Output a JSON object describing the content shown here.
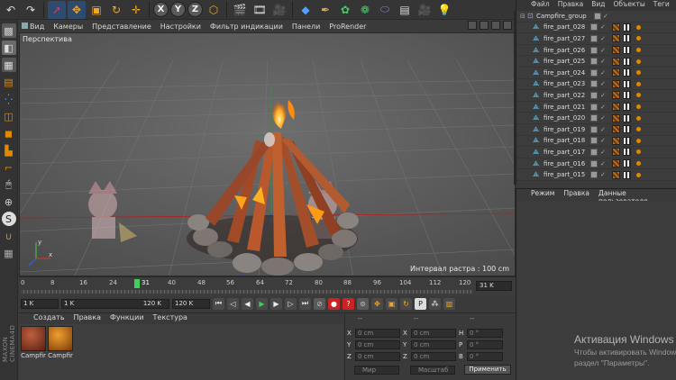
{
  "top_menu": [
    "Файл",
    "Правка",
    "Вид",
    "Объекты",
    "Теги"
  ],
  "viewport_menu": [
    "Вид",
    "Камеры",
    "Представление",
    "Настройки",
    "Фильтр индикации",
    "Панели",
    "ProRender"
  ],
  "viewport": {
    "label": "Перспектива",
    "grid_info": "Интервал растра : 100 cm"
  },
  "timeline": {
    "ticks": [
      "0",
      "8",
      "16",
      "24",
      "31",
      "40",
      "48",
      "56",
      "64",
      "72",
      "80",
      "88",
      "96",
      "104",
      "112",
      "120"
    ],
    "current_frame": 31,
    "end_field": "31 K"
  },
  "transport": {
    "start_field": "1 K",
    "min_field": "1 K",
    "max_field": "120 K",
    "end_field": "120 K"
  },
  "material_menu": [
    "Создать",
    "Правка",
    "Функции",
    "Текстура"
  ],
  "materials": [
    {
      "name": "Campfir",
      "color": "#8a3a22"
    },
    {
      "name": "Campfir",
      "color": "#c96a18"
    }
  ],
  "coordinates": {
    "header_left": "--",
    "header_mid": "--",
    "header_right": "--",
    "rows": [
      {
        "a_label": "X",
        "a_val": "0 cm",
        "b_label": "X",
        "b_val": "0 cm",
        "c_label": "H",
        "c_val": "0 °"
      },
      {
        "a_label": "Y",
        "a_val": "0 cm",
        "b_label": "Y",
        "b_val": "0 cm",
        "c_label": "P",
        "c_val": "0 °"
      },
      {
        "a_label": "Z",
        "a_val": "0 cm",
        "b_label": "Z",
        "b_val": "0 cm",
        "c_label": "B",
        "c_val": "0 °"
      }
    ],
    "mode_dropdown": "Мир",
    "scale_dropdown": "Масштаб",
    "apply_button": "Применить"
  },
  "objects": {
    "group": "Campfire_group",
    "items": [
      "fire_part_028",
      "fire_part_027",
      "fire_part_026",
      "fire_part_025",
      "fire_part_024",
      "fire_part_023",
      "fire_part_022",
      "fire_part_021",
      "fire_part_020",
      "fire_part_019",
      "fire_part_018",
      "fire_part_017",
      "fire_part_016",
      "fire_part_015"
    ]
  },
  "attributes_menu": [
    "Режим",
    "Правка",
    "Данные пользователя"
  ],
  "branding": "MAXON CINEMA4D",
  "windows_notice": {
    "title": "Активация Windows",
    "line1": "Чтобы активировать Windows",
    "line2": "раздел \"Параметры\"."
  },
  "colors": {
    "playhead": "#3fcf5a",
    "selection": "#2e4a6e",
    "tag_dot": "#e08a00"
  }
}
